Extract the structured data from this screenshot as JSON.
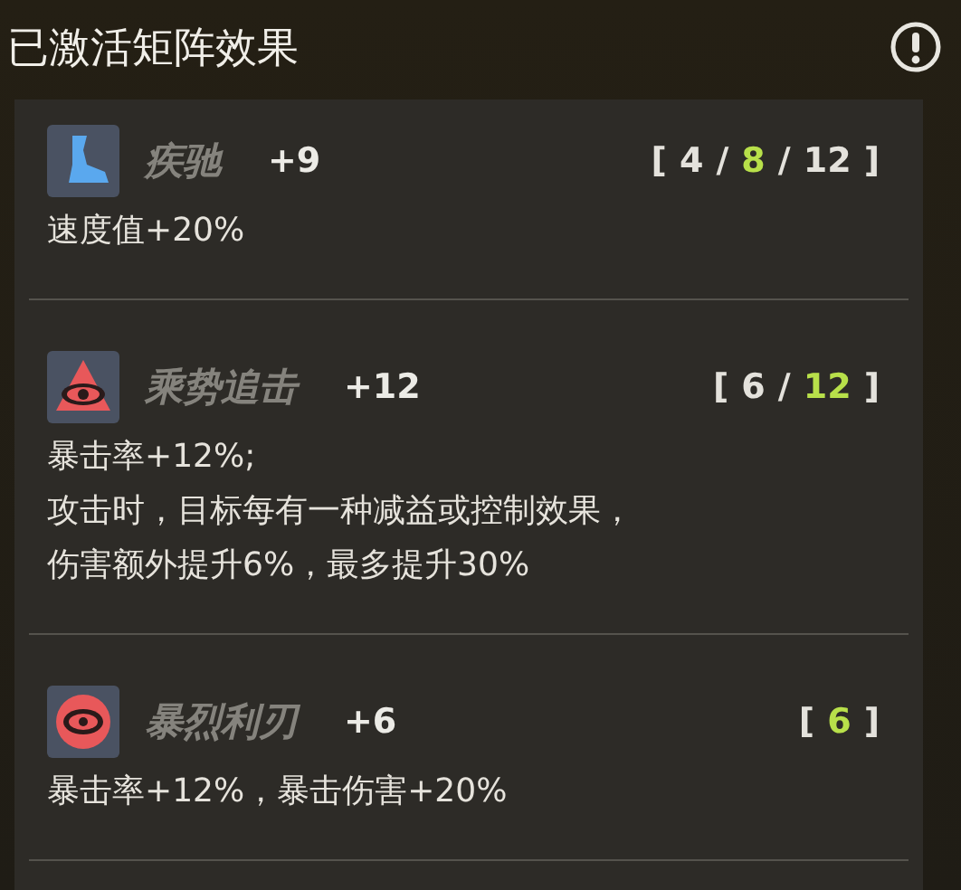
{
  "title": "已激活矩阵效果",
  "info_icon": {
    "kind": "exclamation"
  },
  "effects": [
    {
      "name": "疾驰",
      "bonus": "+9",
      "bracket_open": "[",
      "separator": "/",
      "bracket_close": "]",
      "thresholds": [
        {
          "value": "4",
          "active": false
        },
        {
          "value": "8",
          "active": true
        },
        {
          "value": "12",
          "active": false
        }
      ],
      "description": [
        "速度值+20%"
      ]
    },
    {
      "name": "乘势追击",
      "bonus": "+12",
      "bracket_open": "[",
      "separator": "/",
      "bracket_close": "]",
      "thresholds": [
        {
          "value": "6",
          "active": false
        },
        {
          "value": "12",
          "active": true
        }
      ],
      "description": [
        "暴击率+12%;",
        "攻击时，目标每有一种减益或控制效果，",
        "伤害额外提升6%，最多提升30%"
      ]
    },
    {
      "name": "暴烈利刃",
      "bonus": "+6",
      "bracket_open": "[",
      "bracket_close": "]",
      "thresholds": [
        {
          "value": "6",
          "active": true
        }
      ],
      "description": [
        "暴击率+12%，暴击伤害+20%"
      ]
    }
  ]
}
